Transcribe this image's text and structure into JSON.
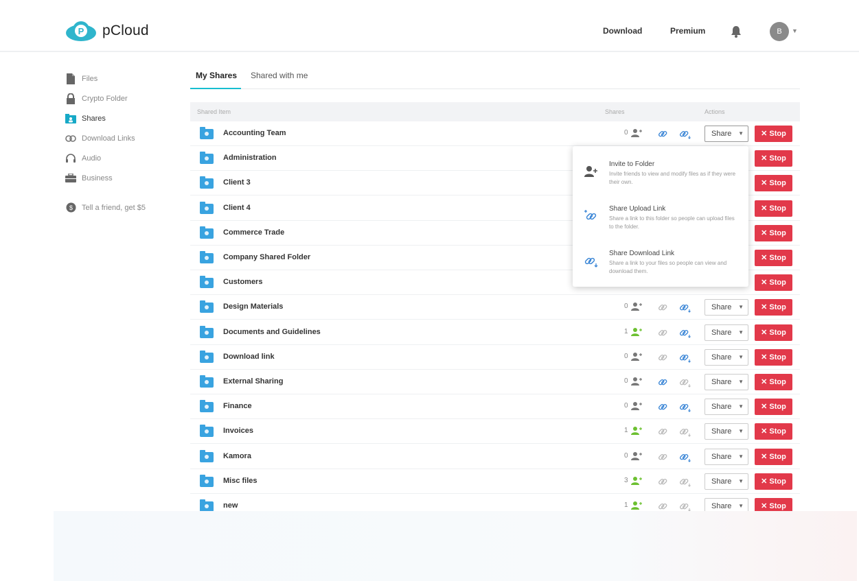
{
  "app": {
    "name": "pCloud",
    "logo_letter": "P"
  },
  "header": {
    "download_label": "Download",
    "premium_label": "Premium",
    "avatar_initial": "B"
  },
  "sidebar": {
    "items": [
      {
        "label": "Files",
        "icon": "file-icon"
      },
      {
        "label": "Crypto Folder",
        "icon": "lock-icon"
      },
      {
        "label": "Shares",
        "icon": "shared-folder-icon",
        "active": true
      },
      {
        "label": "Download Links",
        "icon": "link-icon"
      },
      {
        "label": "Audio",
        "icon": "headphones-icon"
      },
      {
        "label": "Business",
        "icon": "briefcase-icon"
      }
    ],
    "promo": {
      "label": "Tell a friend, get $5",
      "icon": "dollar-icon"
    }
  },
  "tabs": [
    {
      "label": "My Shares",
      "active": true
    },
    {
      "label": "Shared with me",
      "active": false
    }
  ],
  "table": {
    "headers": {
      "item": "Shared Item",
      "shares": "Shares",
      "actions": "Actions"
    },
    "share_label": "Share",
    "stop_label": "✕ Stop",
    "rows": [
      {
        "name": "Accounting Team",
        "count": "0",
        "user_green": false,
        "upload_active": true,
        "download_active": true
      },
      {
        "name": "Administration"
      },
      {
        "name": "Client 3"
      },
      {
        "name": "Client 4"
      },
      {
        "name": "Commerce Trade"
      },
      {
        "name": "Company Shared Folder"
      },
      {
        "name": "Customers"
      },
      {
        "name": "Design Materials",
        "count": "0",
        "user_green": false,
        "upload_active": false,
        "download_active": true
      },
      {
        "name": "Documents and Guidelines",
        "count": "1",
        "user_green": true,
        "upload_active": false,
        "download_active": true
      },
      {
        "name": "Download link",
        "count": "0",
        "user_green": false,
        "upload_active": false,
        "download_active": true
      },
      {
        "name": "External Sharing",
        "count": "0",
        "user_green": false,
        "upload_active": true,
        "download_active": false
      },
      {
        "name": "Finance",
        "count": "0",
        "user_green": false,
        "upload_active": true,
        "download_active": true
      },
      {
        "name": "Invoices",
        "count": "1",
        "user_green": true,
        "upload_active": false,
        "download_active": false
      },
      {
        "name": "Kamora",
        "count": "0",
        "user_green": false,
        "upload_active": false,
        "download_active": true
      },
      {
        "name": "Misc files",
        "count": "3",
        "user_green": true,
        "upload_active": false,
        "download_active": false
      },
      {
        "name": "new",
        "count": "1",
        "user_green": true,
        "upload_active": false,
        "download_active": false
      }
    ]
  },
  "dropdown": {
    "items": [
      {
        "title": "Invite to Folder",
        "desc": "Invite friends to view and modify files as if they were their own.",
        "icon": "invite-user-icon"
      },
      {
        "title": "Share Upload Link",
        "desc": "Share a link to this folder so people can upload files to the folder.",
        "icon": "upload-link-icon"
      },
      {
        "title": "Share Download Link",
        "desc": "Share a link to your files so people can view and download them.",
        "icon": "download-link-icon"
      }
    ]
  },
  "colors": {
    "accent": "#17bed0",
    "folder": "#39a3e0",
    "stop": "#e2394a",
    "share_green": "#6cc030",
    "link_blue": "#3b86d6"
  }
}
